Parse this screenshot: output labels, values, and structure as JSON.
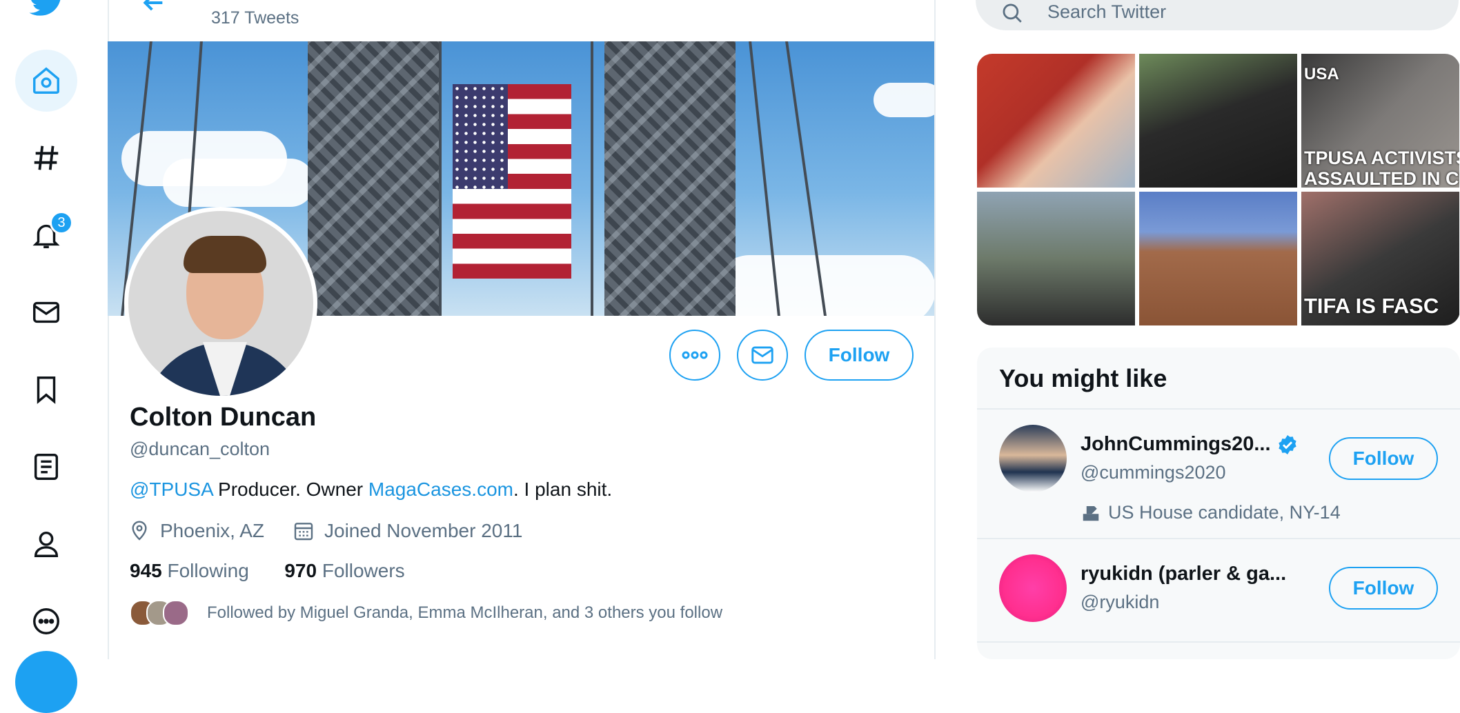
{
  "nav": {
    "items": [
      {
        "icon": "home-icon",
        "active": true
      },
      {
        "icon": "hashtag-icon"
      },
      {
        "icon": "bell-icon",
        "badge": "3"
      },
      {
        "icon": "mail-icon"
      },
      {
        "icon": "bookmark-icon"
      },
      {
        "icon": "list-icon"
      },
      {
        "icon": "profile-icon"
      },
      {
        "icon": "more-icon"
      }
    ]
  },
  "header": {
    "tweets_count": "317 Tweets"
  },
  "profile": {
    "follow_label": "Follow",
    "name": "Colton Duncan",
    "handle": "@duncan_colton",
    "bio": {
      "mention": "@TPUSA",
      "part1": " Producer. Owner ",
      "link": "MagaCases.com",
      "part2": ". I plan shit."
    },
    "location": "Phoenix, AZ",
    "joined": "Joined November 2011",
    "following_count": "945",
    "following_label": "Following",
    "followers_count": "970",
    "followers_label": "Followers",
    "followed_by": "Followed by Miguel Granda, Emma McIlheran, and 3 others you follow"
  },
  "sidebar": {
    "search_placeholder": "Search Twitter",
    "media_captions": {
      "tile3": "TPUSA ACTIVISTS\nASSAULTED IN CHA",
      "tile3_top": "USA",
      "tile6": "TIFA IS FASC"
    },
    "you_might_like": {
      "title": "You might like",
      "suggestions": [
        {
          "name": "JohnCummings20...",
          "handle": "@cummings2020",
          "description": "US House candidate, NY-14",
          "follow": "Follow",
          "verified": true
        },
        {
          "name": "ryukidn (parler & ga...",
          "handle": "@ryukidn",
          "follow": "Follow"
        }
      ]
    }
  },
  "colors": {
    "accent": "#1da1f2",
    "link": "#1b95e0",
    "muted": "#5b7083"
  }
}
